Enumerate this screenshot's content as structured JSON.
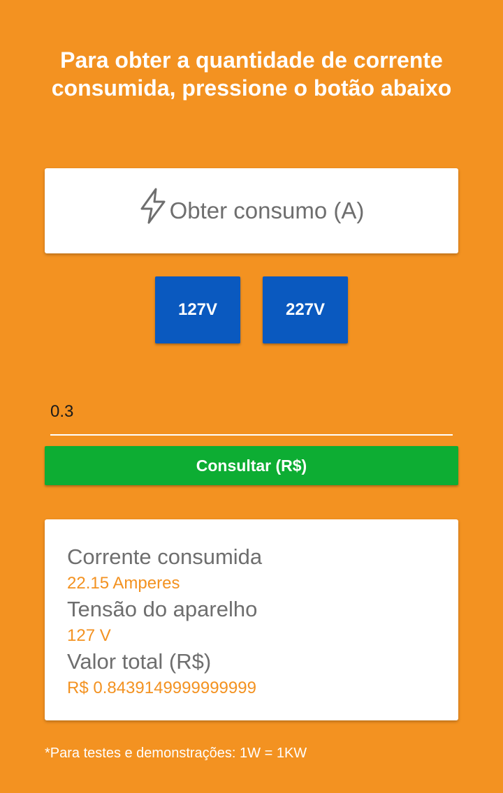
{
  "header": {
    "title": "Para obter a quantidade de corrente consumida, pressione o botão abaixo"
  },
  "action_card": {
    "icon": "lightning-bolt-icon",
    "label": "Obter consumo (A)"
  },
  "voltage_buttons": {
    "v127": "127V",
    "v227": "227V"
  },
  "input": {
    "value": "0.3"
  },
  "consult_button": {
    "label": "Consultar (R$)"
  },
  "results": {
    "current_label": "Corrente consumida",
    "current_value": "22.15 Amperes",
    "voltage_label": "Tensão do aparelho",
    "voltage_value": "127 V",
    "total_label": "Valor total (R$)",
    "total_value": "R$ 0.8439149999999999"
  },
  "footnote": "*Para testes e demonstrações: 1W = 1KW",
  "colors": {
    "background": "#F39221",
    "voltage_button": "#0A59BF",
    "consult_button": "#0DAD33",
    "accent_text": "#F39221"
  }
}
